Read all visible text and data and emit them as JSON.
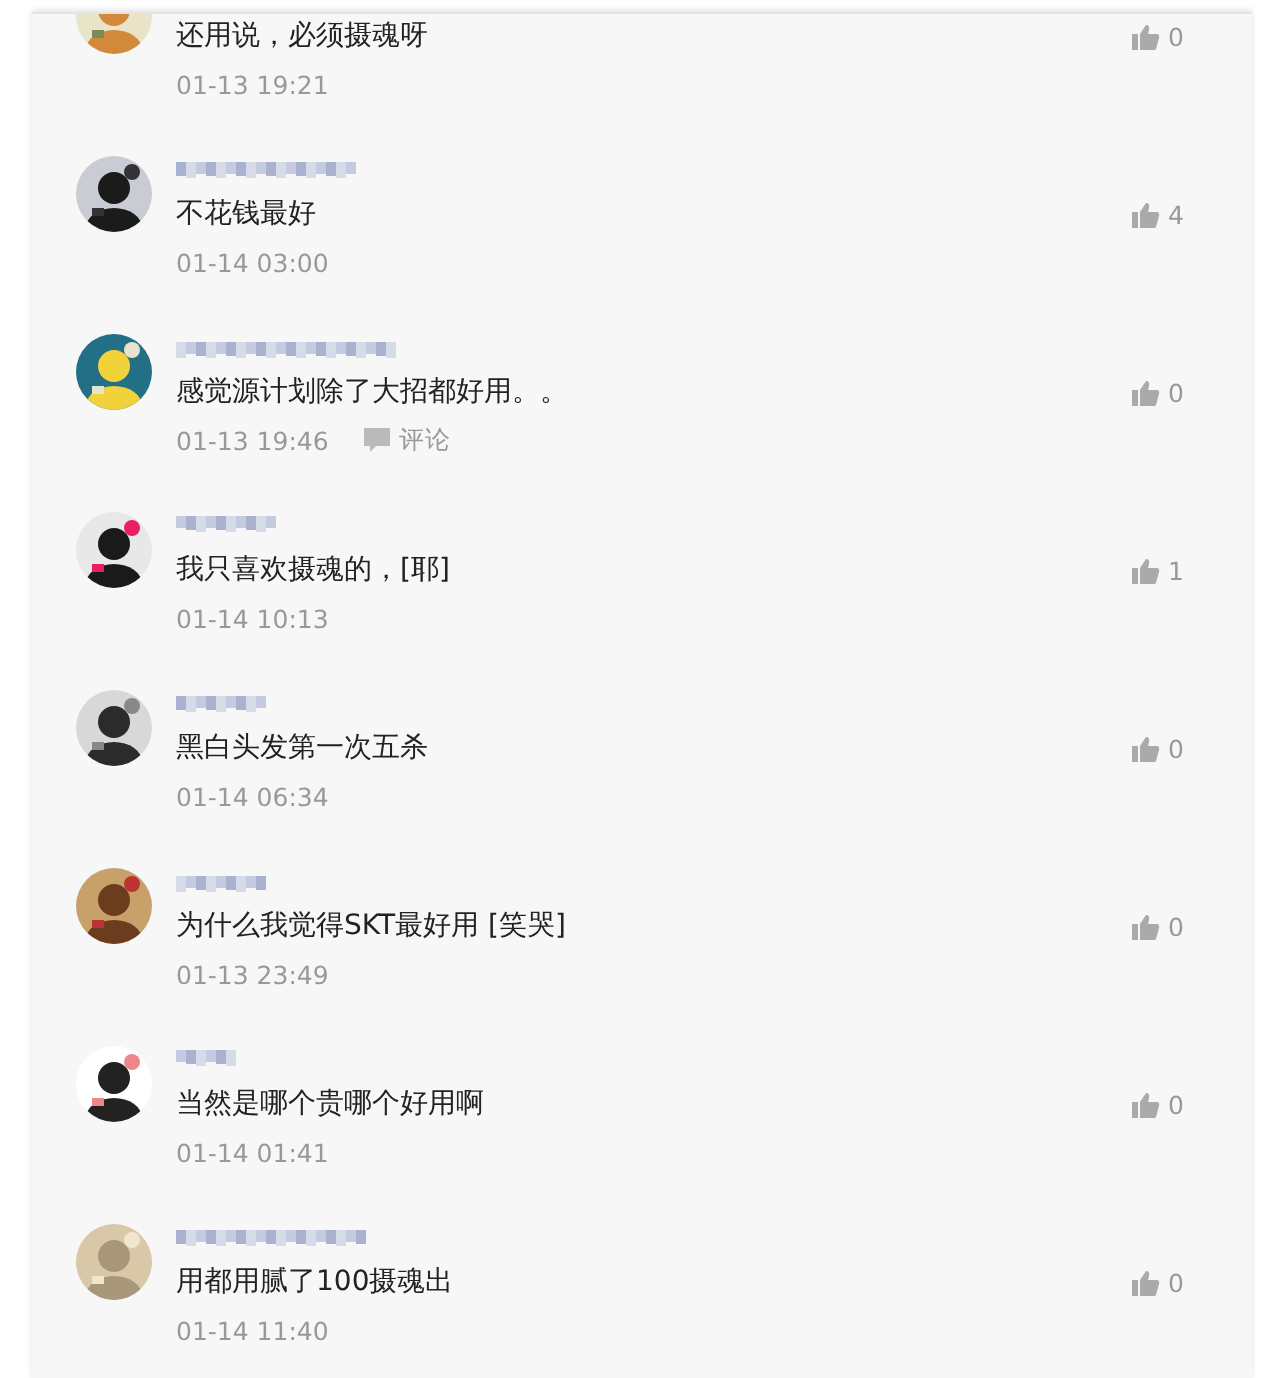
{
  "comments": [
    {
      "cut_off": true,
      "text": "还用说，必须摄魂呀",
      "time": "01-13 19:21",
      "likes": "0"
    },
    {
      "cut_off": false,
      "text": "不花钱最好",
      "time": "01-14 03:00",
      "likes": "4"
    },
    {
      "cut_off": false,
      "text": "感觉源计划除了大招都好用。。",
      "time": "01-13 19:46",
      "likes": "0",
      "reply_label": "评论"
    },
    {
      "cut_off": false,
      "text": "我只喜欢摄魂的，[耶]",
      "time": "01-14 10:13",
      "likes": "1"
    },
    {
      "cut_off": false,
      "text": "黑白头发第一次五杀",
      "time": "01-14 06:34",
      "likes": "0"
    },
    {
      "cut_off": false,
      "text": "为什么我觉得SKT最好用 [笑哭]",
      "time": "01-13 23:49",
      "likes": "0"
    },
    {
      "cut_off": false,
      "text": "当然是哪个贵哪个好用啊",
      "time": "01-14 01:41",
      "likes": "0"
    },
    {
      "cut_off": false,
      "text": "用都用腻了100摄魂出",
      "time": "01-14 11:40",
      "likes": "0"
    }
  ]
}
